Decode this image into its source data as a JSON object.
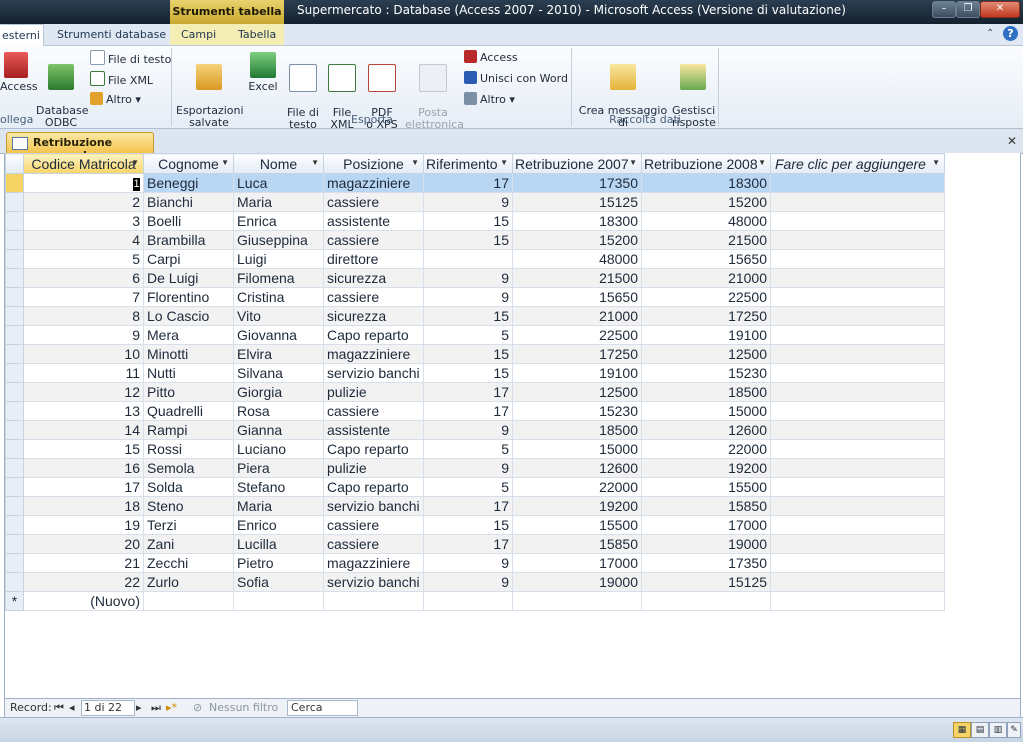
{
  "titlebar": {
    "context_tab": "Strumenti tabella",
    "title": "Supermercato : Database (Access 2007 - 2010)  -  Microsoft Access (Versione di valutazione)"
  },
  "ribbon_tabs": [
    {
      "label": "esterni",
      "active": true
    },
    {
      "label": "Strumenti database",
      "active": false
    },
    {
      "label": "Campi",
      "active": false
    },
    {
      "label": "Tabella",
      "active": false
    }
  ],
  "ribbon": {
    "import": {
      "access": "Access",
      "odbc": "Database\nODBC",
      "file_testo": "File di testo",
      "file_xml": "File XML",
      "altro": "Altro",
      "group": "ollega"
    },
    "export": {
      "saved": "Esportazioni\nsalvate",
      "excel": "Excel",
      "file_testo": "File di\ntesto",
      "file_xml": "File\nXML",
      "pdf": "PDF\no XPS",
      "posta": "Posta\nelettronica",
      "access": "Access",
      "word": "Unisci con Word",
      "altro": "Altro",
      "group": "Esporta"
    },
    "collect": {
      "crea": "Crea messaggio di\nposta elettronica",
      "gestisci": "Gestisci\nrisposte",
      "group": "Raccolta dati"
    }
  },
  "doc_tab": {
    "label": "Retribuzione personale"
  },
  "table": {
    "headers": [
      "Codice Matricola",
      "Cognome",
      "Nome",
      "Posizione",
      "Riferimento",
      "Retribuzione 2007",
      "Retribuzione 2008",
      "Fare clic per aggiungere"
    ],
    "rows": [
      [
        "1",
        "Beneggi",
        "Luca",
        "magazziniere",
        "17",
        "17350",
        "18300"
      ],
      [
        "2",
        "Bianchi",
        "Maria",
        "cassiere",
        "9",
        "15125",
        "15200"
      ],
      [
        "3",
        "Boelli",
        "Enrica",
        "assistente",
        "15",
        "18300",
        "48000"
      ],
      [
        "4",
        "Brambilla",
        "Giuseppina",
        "cassiere",
        "15",
        "15200",
        "21500"
      ],
      [
        "5",
        "Carpi",
        "Luigi",
        "direttore",
        "",
        "48000",
        "15650"
      ],
      [
        "6",
        "De Luigi",
        "Filomena",
        "sicurezza",
        "9",
        "21500",
        "21000"
      ],
      [
        "7",
        "Florentino",
        "Cristina",
        "cassiere",
        "9",
        "15650",
        "22500"
      ],
      [
        "8",
        "Lo Cascio",
        "Vito",
        "sicurezza",
        "15",
        "21000",
        "17250"
      ],
      [
        "9",
        "Mera",
        "Giovanna",
        "Capo reparto",
        "5",
        "22500",
        "19100"
      ],
      [
        "10",
        "Minotti",
        "Elvira",
        "magazziniere",
        "15",
        "17250",
        "12500"
      ],
      [
        "11",
        "Nutti",
        "Silvana",
        "servizio banchi",
        "15",
        "19100",
        "15230"
      ],
      [
        "12",
        "Pitto",
        "Giorgia",
        "pulizie",
        "17",
        "12500",
        "18500"
      ],
      [
        "13",
        "Quadrelli",
        "Rosa",
        "cassiere",
        "17",
        "15230",
        "15000"
      ],
      [
        "14",
        "Rampi",
        "Gianna",
        "assistente",
        "9",
        "18500",
        "12600"
      ],
      [
        "15",
        "Rossi",
        "Luciano",
        "Capo reparto",
        "5",
        "15000",
        "22000"
      ],
      [
        "16",
        "Semola",
        "Piera",
        "pulizie",
        "9",
        "12600",
        "19200"
      ],
      [
        "17",
        "Solda",
        "Stefano",
        "Capo reparto",
        "5",
        "22000",
        "15500"
      ],
      [
        "18",
        "Steno",
        "Maria",
        "servizio banchi",
        "17",
        "19200",
        "15850"
      ],
      [
        "19",
        "Terzi",
        "Enrico",
        "cassiere",
        "15",
        "15500",
        "17000"
      ],
      [
        "20",
        "Zani",
        "Lucilla",
        "cassiere",
        "17",
        "15850",
        "19000"
      ],
      [
        "21",
        "Zecchi",
        "Pietro",
        "magazziniere",
        "9",
        "17000",
        "17350"
      ],
      [
        "22",
        "Zurlo",
        "Sofia",
        "servizio banchi",
        "9",
        "19000",
        "15125"
      ]
    ],
    "new_row_label": "(Nuovo)",
    "new_row_marker": "*"
  },
  "navbar": {
    "record_label": "Record:",
    "record_pos": "1 di 22",
    "filter": "Nessun filtro",
    "search": "Cerca"
  }
}
